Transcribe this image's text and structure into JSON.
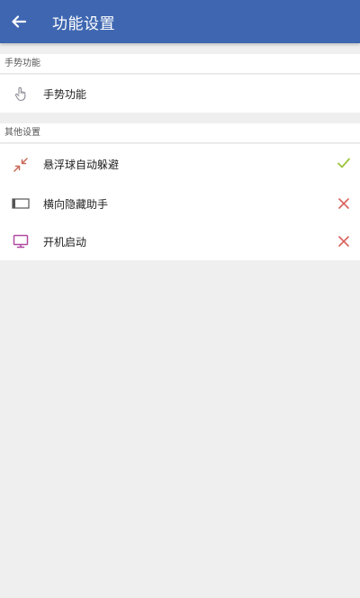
{
  "header": {
    "back_icon": "arrow-left-icon",
    "title": "功能设置"
  },
  "sections": {
    "gesture": {
      "header": "手势功能",
      "items": [
        {
          "label": "手势功能",
          "icon": "hand-pointer-icon"
        }
      ]
    },
    "other": {
      "header": "其他设置",
      "items": [
        {
          "label": "悬浮球自动躲避",
          "icon": "collapse-arrows-icon",
          "status": "checkmark-icon",
          "enabled": true
        },
        {
          "label": "横向隐藏助手",
          "icon": "rectangle-edge-icon",
          "status": "cross-icon",
          "enabled": false
        },
        {
          "label": "开机启动",
          "icon": "monitor-icon",
          "status": "cross-icon",
          "enabled": false
        }
      ]
    }
  },
  "colors": {
    "app_bar": "#3f67b1",
    "check_green": "#9cc43c",
    "cross_red": "#d9605a",
    "page_bg": "#efefef"
  }
}
